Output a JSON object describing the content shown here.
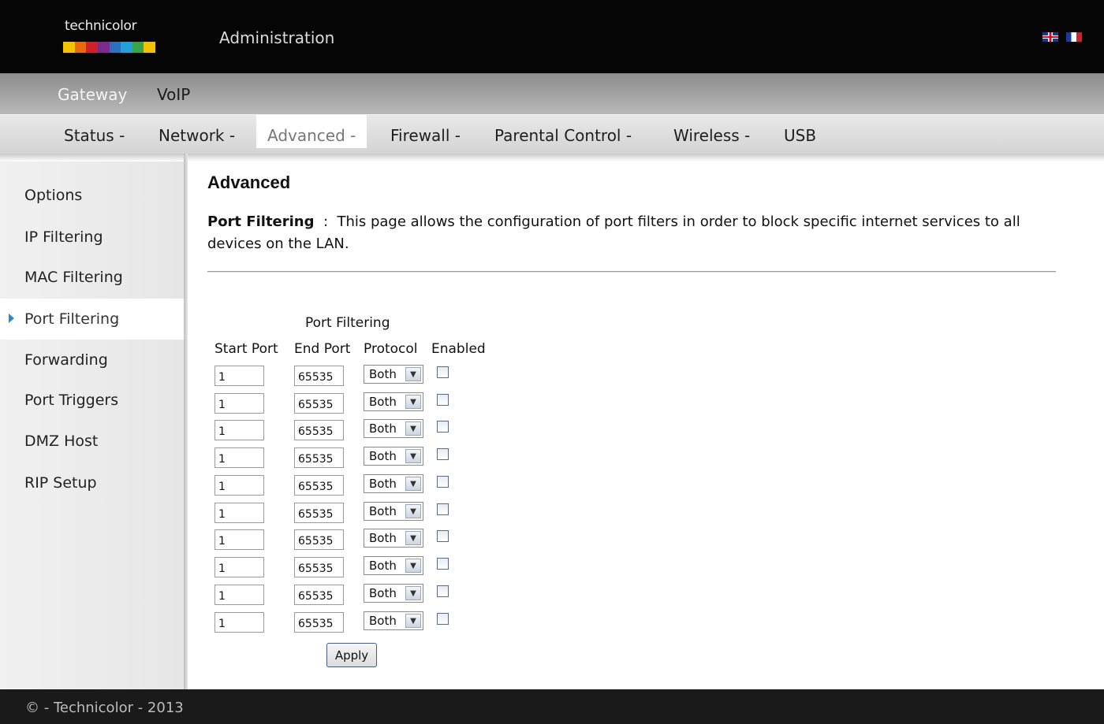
{
  "header": {
    "logo_text": "technicolor",
    "logo_colors": [
      "#f2c400",
      "#e86a10",
      "#d0202e",
      "#7a2b8c",
      "#2a6fc0",
      "#23a0d8",
      "#3aa44a",
      "#f2c400"
    ],
    "title": "Administration",
    "languages": [
      "English",
      "Français"
    ]
  },
  "top_nav": {
    "gateway": "Gateway",
    "voip": "VoIP"
  },
  "main_nav": {
    "status": "Status -",
    "network": "Network -",
    "advanced": "Advanced -",
    "firewall": "Firewall -",
    "parental": "Parental Control -",
    "wireless": "Wireless -",
    "usb": "USB"
  },
  "sidebar": {
    "items": [
      "Options",
      "IP Filtering",
      "MAC Filtering",
      "Port Filtering",
      "Forwarding",
      "Port Triggers",
      "DMZ Host",
      "RIP Setup"
    ],
    "active": "Port Filtering"
  },
  "main": {
    "title": "Advanced",
    "desc_label": "Port Filtering",
    "desc_sep": "  :  ",
    "desc_text": "This page allows the configuration of port filters in order to block specific internet services to all devices on the LAN.",
    "table_caption": "Port Filtering",
    "columns": {
      "start": "Start Port",
      "end": "End Port",
      "protocol": "Protocol",
      "enabled": "Enabled"
    },
    "rows": [
      {
        "start": "1",
        "end": "65535",
        "protocol": "Both",
        "enabled": false
      },
      {
        "start": "1",
        "end": "65535",
        "protocol": "Both",
        "enabled": false
      },
      {
        "start": "1",
        "end": "65535",
        "protocol": "Both",
        "enabled": false
      },
      {
        "start": "1",
        "end": "65535",
        "protocol": "Both",
        "enabled": false
      },
      {
        "start": "1",
        "end": "65535",
        "protocol": "Both",
        "enabled": false
      },
      {
        "start": "1",
        "end": "65535",
        "protocol": "Both",
        "enabled": false
      },
      {
        "start": "1",
        "end": "65535",
        "protocol": "Both",
        "enabled": false
      },
      {
        "start": "1",
        "end": "65535",
        "protocol": "Both",
        "enabled": false
      },
      {
        "start": "1",
        "end": "65535",
        "protocol": "Both",
        "enabled": false
      },
      {
        "start": "1",
        "end": "65535",
        "protocol": "Both",
        "enabled": false
      }
    ],
    "apply_label": "Apply"
  },
  "footer": {
    "text": "© - Technicolor - 2013"
  }
}
